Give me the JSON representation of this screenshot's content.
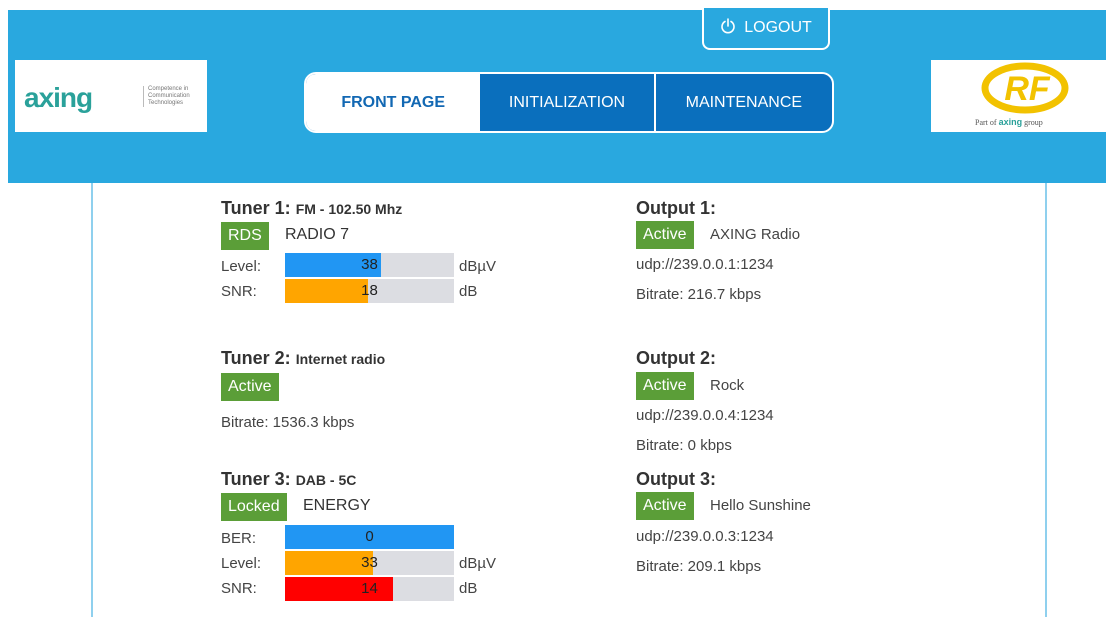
{
  "header": {
    "logout_label": "LOGOUT",
    "logo_left": {
      "word": "axing",
      "tagline_1": "Competence in",
      "tagline_2": "Communication",
      "tagline_3": "Technologies"
    },
    "logo_right": {
      "mark": "RF",
      "sub_prefix": "Part of",
      "sub_brand": "axing",
      "sub_suffix": "group"
    }
  },
  "nav": {
    "tabs": [
      {
        "label": "FRONT PAGE",
        "active": true
      },
      {
        "label": "INITIALIZATION",
        "active": false
      },
      {
        "label": "MAINTENANCE",
        "active": false
      }
    ]
  },
  "colors": {
    "header_bg": "#29a8df",
    "nav_bg": "#0a6fbd",
    "badge_green": "#5b9e38",
    "bar_blue": "#2196f3",
    "bar_orange": "#ffa500",
    "bar_red": "#ff0000",
    "bar_track": "#dcdde2"
  },
  "tuners": [
    {
      "title": "Tuner 1:",
      "subtitle": "FM - 102.50 Mhz",
      "badge": "RDS",
      "station": "RADIO 7",
      "metrics": [
        {
          "label": "Level:",
          "value": "38",
          "unit": "dBµV",
          "fill_fraction": 0.57,
          "color": "blue"
        },
        {
          "label": "SNR:",
          "value": "18",
          "unit": "dB",
          "fill_fraction": 0.49,
          "color": "orange"
        }
      ]
    },
    {
      "title": "Tuner 2:",
      "subtitle": "Internet radio",
      "badge": "Active",
      "bitrate": "Bitrate: 1536.3 kbps"
    },
    {
      "title": "Tuner 3:",
      "subtitle": "DAB - 5C",
      "badge": "Locked",
      "station": "ENERGY",
      "metrics": [
        {
          "label": "BER:",
          "value": "0",
          "unit": "",
          "fill_fraction": 1.0,
          "color": "blue"
        },
        {
          "label": "Level:",
          "value": "33",
          "unit": "dBµV",
          "fill_fraction": 0.52,
          "color": "orange"
        },
        {
          "label": "SNR:",
          "value": "14",
          "unit": "dB",
          "fill_fraction": 0.64,
          "color": "red"
        }
      ]
    }
  ],
  "outputs": [
    {
      "title": "Output 1:",
      "badge": "Active",
      "name": "AXING Radio",
      "url": "udp://239.0.0.1:1234",
      "bitrate": "Bitrate: 216.7 kbps"
    },
    {
      "title": "Output 2:",
      "badge": "Active",
      "name": "Rock",
      "url": "udp://239.0.0.4:1234",
      "bitrate": "Bitrate: 0 kbps"
    },
    {
      "title": "Output 3:",
      "badge": "Active",
      "name": "Hello Sunshine",
      "url": "udp://239.0.0.3:1234",
      "bitrate": "Bitrate: 209.1 kbps"
    }
  ]
}
